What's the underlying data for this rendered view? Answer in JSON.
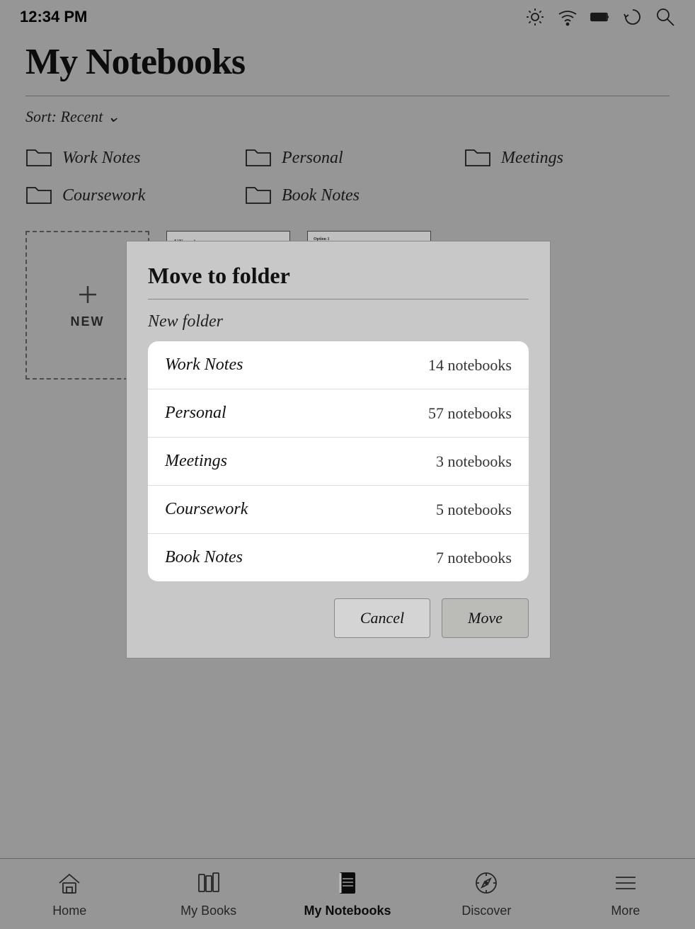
{
  "statusBar": {
    "time": "12:34 PM"
  },
  "header": {
    "title": "My Notebooks"
  },
  "sort": {
    "label": "Sort: Recent ⌄"
  },
  "folders": [
    {
      "name": "Work Notes"
    },
    {
      "name": "Personal"
    },
    {
      "name": "Meetings"
    },
    {
      "name": "Coursework"
    },
    {
      "name": "Book Notes"
    }
  ],
  "newNotebook": {
    "label": "NEW"
  },
  "modal": {
    "title": "Move to folder",
    "newFolder": "New folder",
    "folders": [
      {
        "name": "Work Notes",
        "count": "14 notebooks"
      },
      {
        "name": "Personal",
        "count": "57 notebooks"
      },
      {
        "name": "Meetings",
        "count": "3 notebooks"
      },
      {
        "name": "Coursework",
        "count": "5 notebooks"
      },
      {
        "name": "Book Notes",
        "count": "7 notebooks"
      }
    ],
    "cancelLabel": "Cancel",
    "moveLabel": "Move"
  },
  "tabBar": {
    "tabs": [
      {
        "id": "home",
        "label": "Home",
        "active": false
      },
      {
        "id": "my-books",
        "label": "My Books",
        "active": false
      },
      {
        "id": "my-notebooks",
        "label": "My Notebooks",
        "active": true
      },
      {
        "id": "discover",
        "label": "Discover",
        "active": false
      },
      {
        "id": "more",
        "label": "More",
        "active": false
      }
    ]
  }
}
